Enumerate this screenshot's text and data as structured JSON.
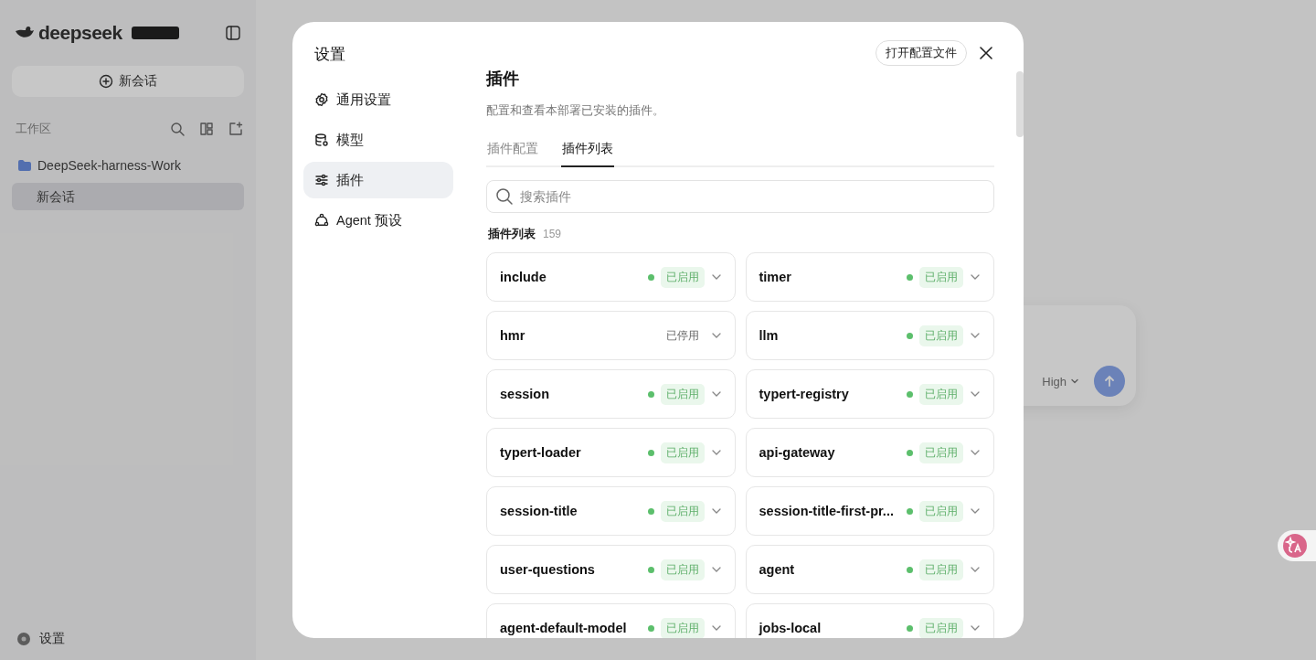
{
  "app": {
    "logo_text": "deepseek",
    "new_chat_button": "新会话",
    "workspace_label": "工作区",
    "project": "DeepSeek-harness-Work",
    "sessions": [
      {
        "title": "新会话",
        "selected": true
      }
    ],
    "settings_link": "设置",
    "composer": {
      "effort": "High"
    }
  },
  "settings_dialog": {
    "title": "设置",
    "open_config_button": "打开配置文件",
    "nav": [
      {
        "kind": "gear",
        "label": "通用设置",
        "selected": false
      },
      {
        "kind": "database",
        "label": "模型",
        "selected": false
      },
      {
        "kind": "sliders",
        "label": "插件",
        "selected": true
      },
      {
        "kind": "agent",
        "label": "Agent 预设",
        "selected": false
      }
    ],
    "heading": "插件",
    "description": "配置和查看本部署已安装的插件。",
    "tabs": [
      {
        "label": "插件配置",
        "selected": false
      },
      {
        "label": "插件列表",
        "selected": true
      }
    ],
    "search": {
      "placeholder": "搜索插件"
    },
    "list_label": "插件列表",
    "list_count": "159",
    "plugins": [
      {
        "name": "include",
        "status": "已启用",
        "enabled": true
      },
      {
        "name": "timer",
        "status": "已启用",
        "enabled": true
      },
      {
        "name": "hmr",
        "status": "已停用",
        "enabled": false
      },
      {
        "name": "llm",
        "status": "已启用",
        "enabled": true
      },
      {
        "name": "session",
        "status": "已启用",
        "enabled": true
      },
      {
        "name": "typert-registry",
        "status": "已启用",
        "enabled": true
      },
      {
        "name": "typert-loader",
        "status": "已启用",
        "enabled": true
      },
      {
        "name": "api-gateway",
        "status": "已启用",
        "enabled": true
      },
      {
        "name": "session-title",
        "status": "已启用",
        "enabled": true
      },
      {
        "name": "session-title-first-pr...",
        "status": "已启用",
        "enabled": true
      },
      {
        "name": "user-questions",
        "status": "已启用",
        "enabled": true
      },
      {
        "name": "agent",
        "status": "已启用",
        "enabled": true
      },
      {
        "name": "agent-default-model",
        "status": "已启用",
        "enabled": true
      },
      {
        "name": "jobs-local",
        "status": "已启用",
        "enabled": true
      }
    ]
  }
}
